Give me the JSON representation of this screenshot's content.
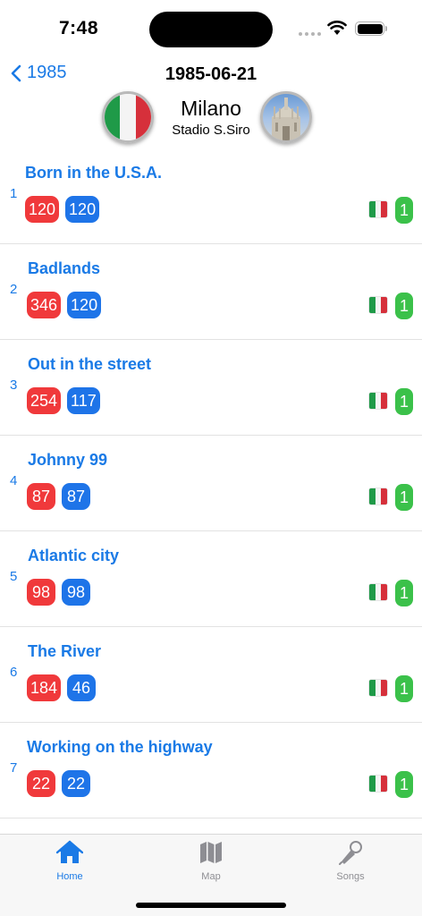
{
  "status_bar": {
    "time": "7:48"
  },
  "nav": {
    "back_label": "1985",
    "title": "1985-06-21"
  },
  "venue": {
    "city": "Milano",
    "stadium": "Stadio S.Siro"
  },
  "songs": [
    {
      "number": "1",
      "title": "Born in the U.S.A.",
      "red_count": "120",
      "blue_count": "120",
      "shows": "1"
    },
    {
      "number": "2",
      "title": "Badlands",
      "red_count": "346",
      "blue_count": "120",
      "shows": "1"
    },
    {
      "number": "3",
      "title": "Out in the street",
      "red_count": "254",
      "blue_count": "117",
      "shows": "1"
    },
    {
      "number": "4",
      "title": "Johnny 99",
      "red_count": "87",
      "blue_count": "87",
      "shows": "1"
    },
    {
      "number": "5",
      "title": "Atlantic city",
      "red_count": "98",
      "blue_count": "98",
      "shows": "1"
    },
    {
      "number": "6",
      "title": "The River",
      "red_count": "184",
      "blue_count": "46",
      "shows": "1"
    },
    {
      "number": "7",
      "title": "Working on the highway",
      "red_count": "22",
      "blue_count": "22",
      "shows": "1"
    }
  ],
  "tabbar": {
    "tabs": [
      {
        "label": "Home",
        "icon": "house-icon",
        "selected": true
      },
      {
        "label": "Map",
        "icon": "map-icon",
        "selected": false
      },
      {
        "label": "Songs",
        "icon": "microphone-icon",
        "selected": false
      }
    ]
  },
  "colors": {
    "accent": "#1a7ae6",
    "badge_red": "#f0393b",
    "badge_blue": "#1e74e8",
    "count_green": "#3bc14a",
    "flag_italy": [
      "#1f9a48",
      "#ffffff",
      "#d6303b"
    ]
  }
}
